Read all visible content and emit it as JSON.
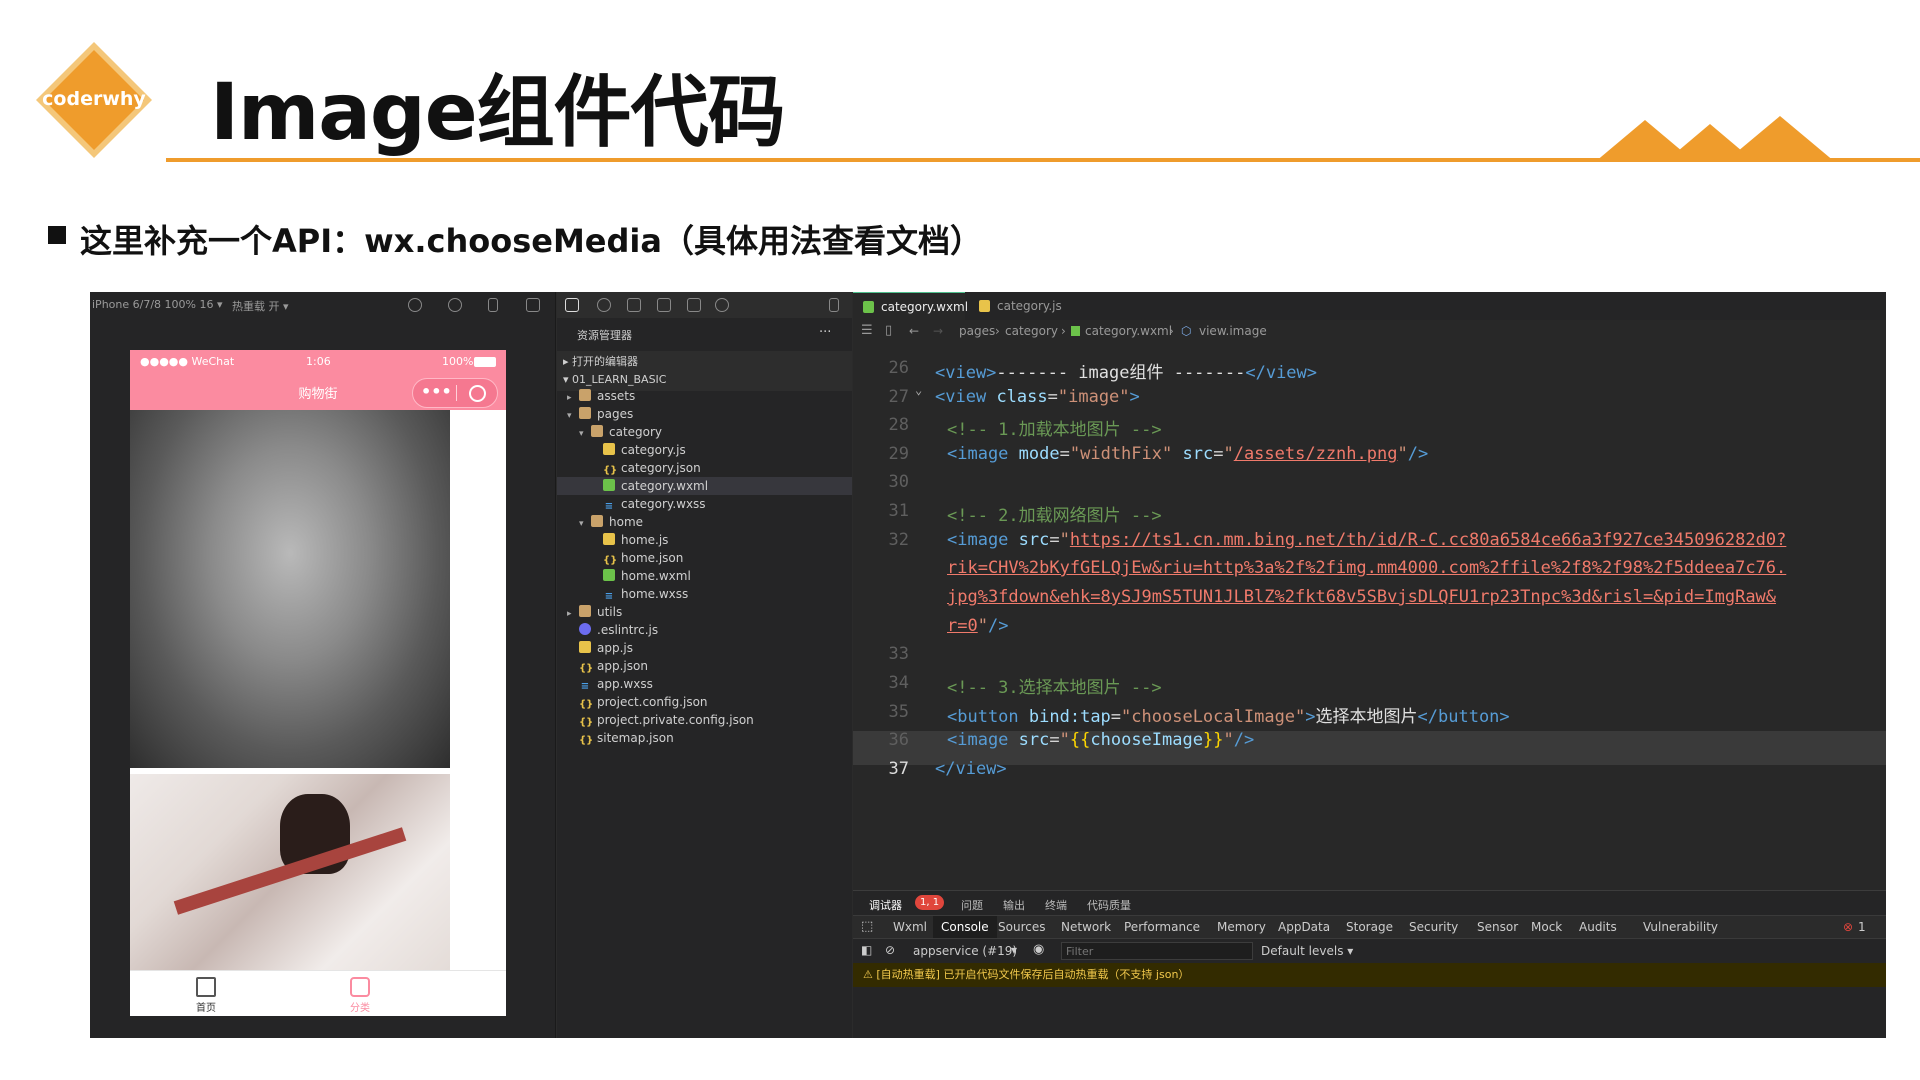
{
  "slide": {
    "logo_text": "coderwhy",
    "title": "Image组件代码",
    "subtitle": "这里补充一个API：wx.chooseMedia（具体用法查看文档）",
    "accent_color": "#ef9c2c"
  },
  "simulator": {
    "device": "iPhone 6/7/8 100% 16 ▾",
    "hot_reload": "热重载 开 ▾",
    "status_carrier": "●●●●● WeChat",
    "status_time": "1:06",
    "status_battery": "100%",
    "nav_title": "购物街",
    "tab_home": "首页",
    "tab_category": "分类"
  },
  "explorer": {
    "header": "资源管理器",
    "more": "···",
    "open_editors": "打开的编辑器",
    "project": "01_LEARN_BASIC",
    "items": [
      {
        "label": "assets",
        "icon": "folder-icon"
      },
      {
        "label": "pages",
        "icon": "folder-icon"
      },
      {
        "label": "category",
        "icon": "folder-icon"
      },
      {
        "label": "category.js",
        "icon": "js-file-icon"
      },
      {
        "label": "category.json",
        "icon": "json-file-icon"
      },
      {
        "label": "category.wxml",
        "icon": "wxml-file-icon"
      },
      {
        "label": "category.wxss",
        "icon": "wxss-file-icon"
      },
      {
        "label": "home",
        "icon": "folder-icon"
      },
      {
        "label": "home.js",
        "icon": "js-file-icon"
      },
      {
        "label": "home.json",
        "icon": "json-file-icon"
      },
      {
        "label": "home.wxml",
        "icon": "wxml-file-icon"
      },
      {
        "label": "home.wxss",
        "icon": "wxss-file-icon"
      },
      {
        "label": "utils",
        "icon": "folder-icon"
      },
      {
        "label": ".eslintrc.js",
        "icon": "eslint-icon"
      },
      {
        "label": "app.js",
        "icon": "js-file-icon"
      },
      {
        "label": "app.json",
        "icon": "json-file-icon"
      },
      {
        "label": "app.wxss",
        "icon": "wxss-file-icon"
      },
      {
        "label": "project.config.json",
        "icon": "json-file-icon"
      },
      {
        "label": "project.private.config.json",
        "icon": "json-file-icon"
      },
      {
        "label": "sitemap.json",
        "icon": "json-file-icon"
      }
    ]
  },
  "editor": {
    "tab_active": "category.wxml",
    "tab_other": "category.js",
    "breadcrumb": {
      "pages": "pages",
      "category": "category",
      "file": "category.wxml",
      "symbol": "view.image"
    },
    "line_numbers": [
      "26",
      "27",
      "28",
      "29",
      "30",
      "31",
      "32",
      "33",
      "34",
      "35",
      "36",
      "37"
    ],
    "code": {
      "l26_open": "<view>",
      "l26_text": "------- image组件 -------",
      "l26_close": "</view>",
      "l27_tag": "<view",
      "l27_attr": "class",
      "l27_val": "\"image\"",
      "l28": "<!-- 1.加载本地图片 -->",
      "l29_tag": "<image",
      "l29_attr1": "mode",
      "l29_val1": "\"widthFix\"",
      "l29_attr2": "src",
      "l29_val2": "/assets/zznh.png",
      "l31": "<!-- 2.加载网络图片 -->",
      "l32_tag": "<image",
      "l32_attr": "src",
      "l32_url1": "https://ts1.cn.mm.bing.net/th/id/R-C.cc80a6584ce66a3f927ce345096282d0?",
      "l32_url2": "rik=CHV%2bKyfGELQjEw&riu=http%3a%2f%2fimg.mm4000.com%2ffile%2f8%2f98%2f5ddeea7c76.",
      "l32_url3": "jpg%3fdown&ehk=8ySJ9mS5TUN1JLBlZ%2fkt68v5SBvjsDLQFU1rp23Tnpc%3d&risl=&pid=ImgRaw&",
      "l32_url4": "r=0",
      "l34": "<!-- 3.选择本地图片 -->",
      "l35_tag": "<button",
      "l35_attr": "bind:tap",
      "l35_val": "\"chooseLocalImage\"",
      "l35_text": "选择本地图片",
      "l35_close": "</button>",
      "l36_tag": "<image",
      "l36_attr": "src",
      "l36_expr": "chooseImage",
      "l37": "</view>"
    }
  },
  "devtools": {
    "tabs": [
      "调试器",
      "问题",
      "输出",
      "终端",
      "代码质量"
    ],
    "badge": "1, 1",
    "panels": [
      "Wxml",
      "Console",
      "Sources",
      "Network",
      "Performance",
      "Memory",
      "AppData",
      "Storage",
      "Security",
      "Sensor",
      "Mock",
      "Audits",
      "Vulnerability"
    ],
    "error_count": "1",
    "context": "appservice (#19)",
    "filter_placeholder": "Filter",
    "levels": "Default levels ▾",
    "warning": "[自动热重载] 已开启代码文件保存后自动热重载（不支持 json）"
  }
}
